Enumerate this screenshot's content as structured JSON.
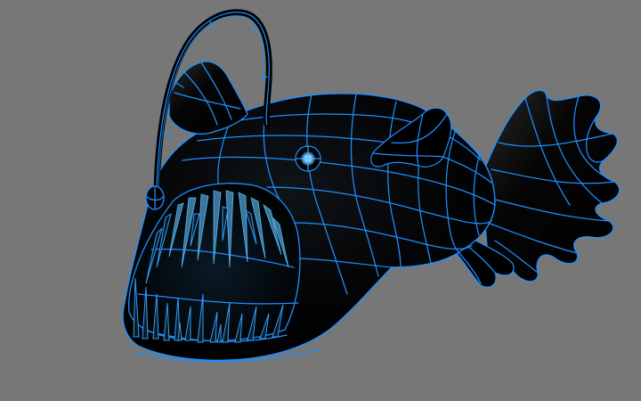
{
  "viewport": {
    "background_color": "#777777",
    "wireframe_color": "#1e8fff",
    "mesh_fill_color": "#000000"
  },
  "model": {
    "subject": "anglerfish",
    "display_mode": "shaded-with-wireframe"
  }
}
